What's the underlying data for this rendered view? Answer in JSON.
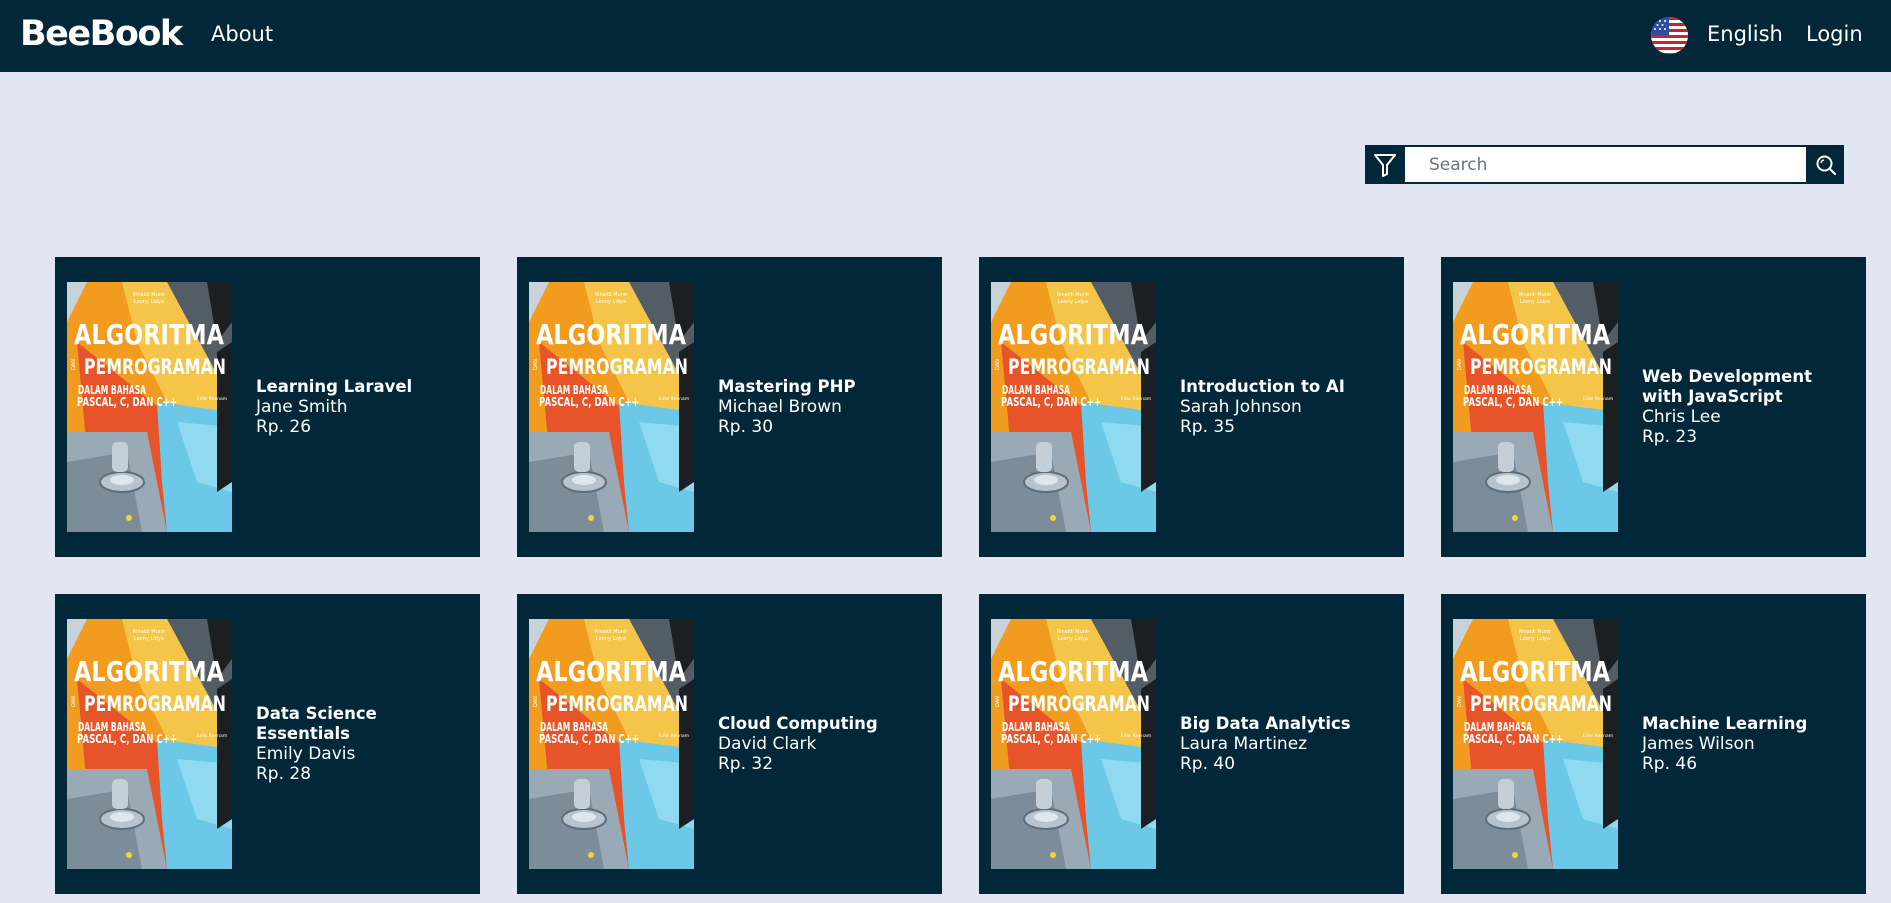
{
  "header": {
    "brand": "BeeBook",
    "nav_about": "About",
    "language": "English",
    "login": "Login",
    "flag_icon": "us-flag-icon"
  },
  "search": {
    "placeholder": "Search",
    "value": ""
  },
  "cover": {
    "authors_line1": "Rinaldi Munir",
    "authors_line2": "Leony Lidya",
    "title_main": "ALGORITMA",
    "title_connector": "DAN",
    "title_sub": "PEMROGRAMAN",
    "subtitle1": "DALAM BAHASA",
    "subtitle2": "PASCAL, C, DAN C++",
    "edition": "Edisi Keenam"
  },
  "books": [
    {
      "title": "Learning Laravel",
      "author": "Jane Smith",
      "price": "Rp. 26"
    },
    {
      "title": "Mastering PHP",
      "author": "Michael Brown",
      "price": "Rp. 30"
    },
    {
      "title": "Introduction to AI",
      "author": "Sarah Johnson",
      "price": "Rp. 35"
    },
    {
      "title": "Web Development with JavaScript",
      "author": "Chris Lee",
      "price": "Rp. 23"
    },
    {
      "title": "Data Science Essentials",
      "author": "Emily Davis",
      "price": "Rp. 28"
    },
    {
      "title": "Cloud Computing",
      "author": "David Clark",
      "price": "Rp. 32"
    },
    {
      "title": "Big Data Analytics",
      "author": "Laura Martinez",
      "price": "Rp. 40"
    },
    {
      "title": "Machine Learning",
      "author": "James Wilson",
      "price": "Rp. 46"
    }
  ],
  "colors": {
    "navbar": "#022738",
    "background": "#e1e6f2",
    "card": "#022738",
    "text": "#ffffff"
  }
}
